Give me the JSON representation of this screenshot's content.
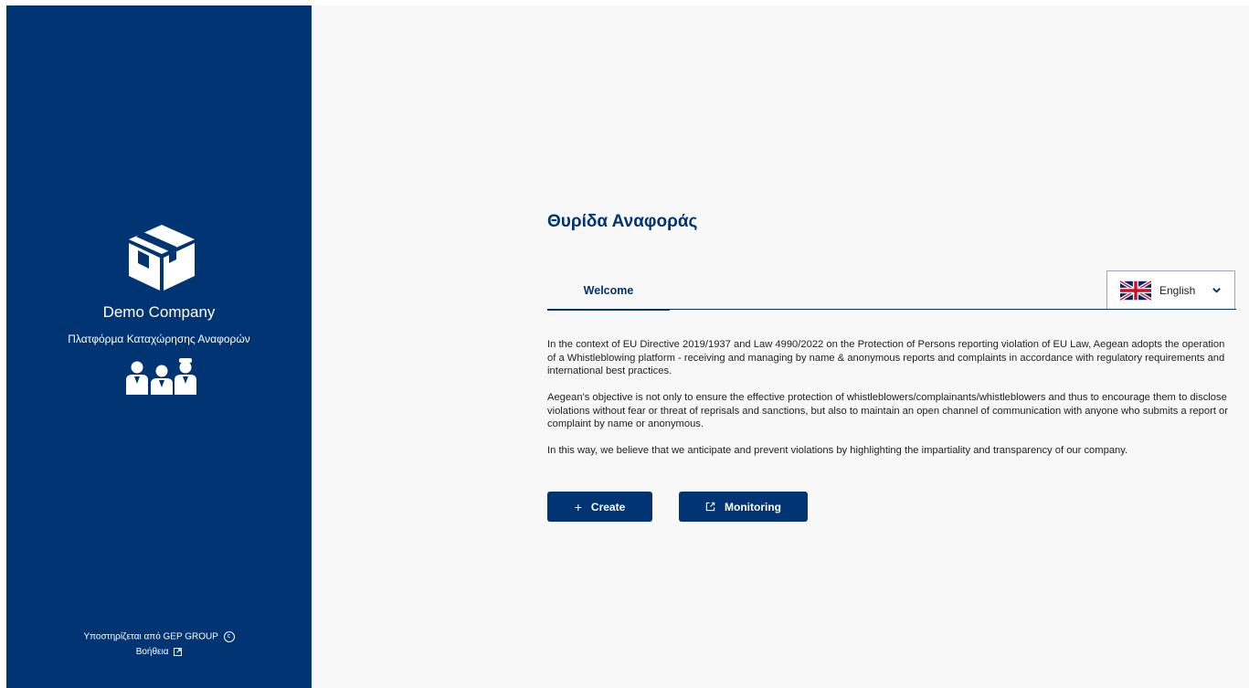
{
  "sidebar": {
    "company_name": "Demo Company",
    "platform_name": "Πλατφόρμα Καταχώρησης Αναφορών",
    "logo_icon": "box-icon",
    "people_icon": "people-icon",
    "supported_by": "Υποστηρίζεται από GEP GROUP",
    "help_label": "Βοήθεια"
  },
  "main": {
    "title": "Θυρίδα Αναφοράς",
    "tabs": [
      {
        "label": "Welcome",
        "active": true
      }
    ],
    "language": {
      "selected": "English",
      "flag_icon": "uk-flag-icon"
    },
    "paragraphs": [
      "In the context of EU Directive 2019/1937 and Law 4990/2022 on the Protection of Persons reporting violation of EU Law, Aegean adopts the operation of a Whistleblowing platform - receiving and managing by name & anonymous reports and complaints in accordance with regulatory requirements and international best practices.",
      "Aegean's objective is not only to ensure the effective protection of whistleblowers/complainants/whistleblowers and thus to encourage them to disclose violations without fear or threat of reprisals and sanctions, but also to maintain an open channel of communication with anyone who submits a report or complaint by name or anonymous.",
      "In this way, we believe that we anticipate and prevent violations by highlighting the impartiality and transparency of our company."
    ],
    "buttons": {
      "create_label": "Create",
      "monitoring_label": "Monitoring"
    }
  },
  "colors": {
    "primary": "#013473",
    "background": "#f8f8f8"
  }
}
